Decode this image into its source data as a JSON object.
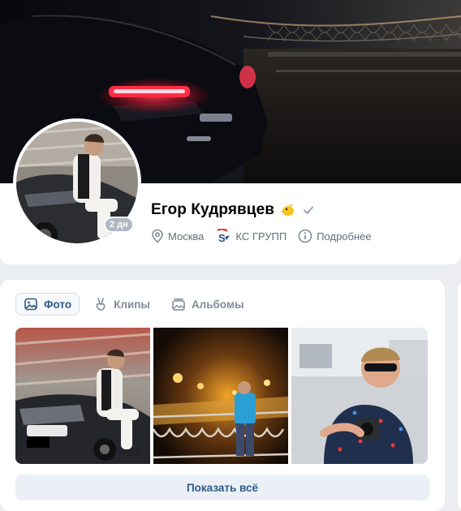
{
  "profile": {
    "name": "Егор Кудрявцев",
    "online_badge": "2 дн",
    "city": "Москва",
    "company": "КС ГРУПП",
    "more_label": "Подробнее"
  },
  "icons": {
    "emoji_status": "chick-icon",
    "verified": "checkmark-icon",
    "location": "location-pin-icon",
    "company": "company-logo-icon",
    "info": "info-icon",
    "photo_tab": "image-icon",
    "clips_tab": "clip-hand-icon",
    "albums_tab": "album-icon"
  },
  "photos_section": {
    "tabs": [
      {
        "label": "Фото"
      },
      {
        "label": "Клипы"
      },
      {
        "label": "Альбомы"
      }
    ],
    "show_all_label": "Показать всё"
  },
  "colors": {
    "accent": "#2d5a8a",
    "secondary_text": "#626d7a",
    "page_bg": "#ebedf0"
  }
}
